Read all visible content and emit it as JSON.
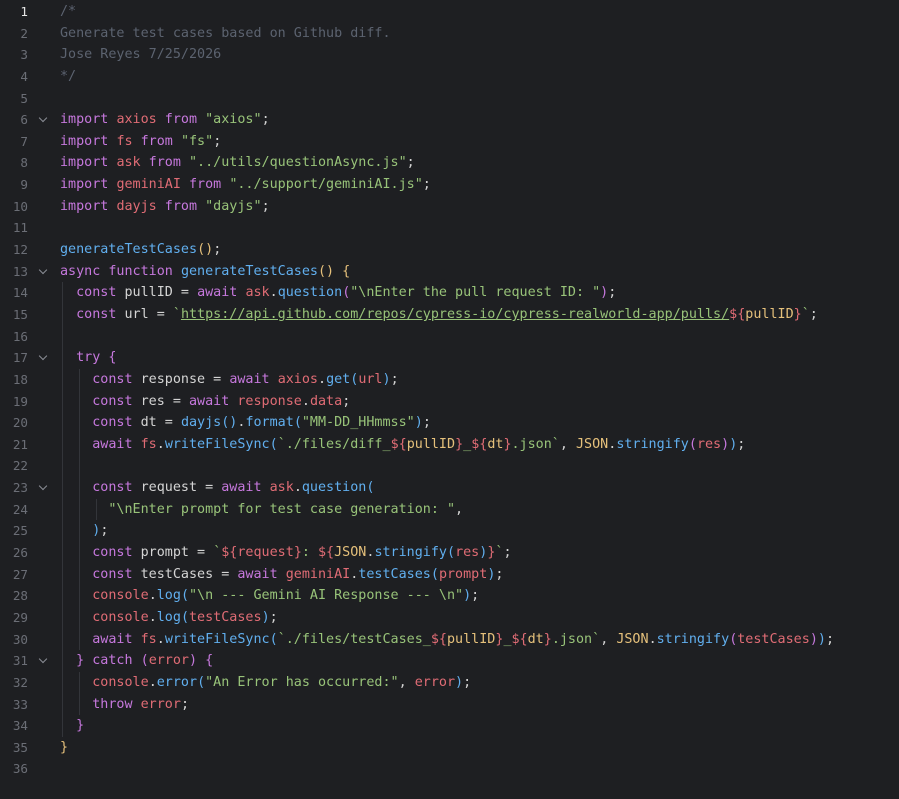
{
  "editor": {
    "active_line": 1,
    "lines": [
      {
        "num": "1",
        "indent": 0,
        "tokens": [
          {
            "t": "/*",
            "c": "cm"
          }
        ]
      },
      {
        "num": "2",
        "indent": 0,
        "tokens": [
          {
            "t": "Generate test cases based on Github diff.",
            "c": "cm"
          }
        ]
      },
      {
        "num": "3",
        "indent": 0,
        "tokens": [
          {
            "t": "Jose Reyes 7/25/2026",
            "c": "cm"
          }
        ]
      },
      {
        "num": "4",
        "indent": 0,
        "tokens": [
          {
            "t": "*/",
            "c": "cm"
          }
        ]
      },
      {
        "num": "5",
        "indent": 0,
        "tokens": []
      },
      {
        "num": "6",
        "indent": 0,
        "fold": true,
        "tokens": [
          {
            "t": "import ",
            "c": "kw"
          },
          {
            "t": "axios",
            "c": "id"
          },
          {
            "t": " from ",
            "c": "kw"
          },
          {
            "t": "\"axios\"",
            "c": "st"
          },
          {
            "t": ";",
            "c": "pl"
          }
        ]
      },
      {
        "num": "7",
        "indent": 0,
        "tokens": [
          {
            "t": "import ",
            "c": "kw"
          },
          {
            "t": "fs",
            "c": "id"
          },
          {
            "t": " from ",
            "c": "kw"
          },
          {
            "t": "\"fs\"",
            "c": "st"
          },
          {
            "t": ";",
            "c": "pl"
          }
        ]
      },
      {
        "num": "8",
        "indent": 0,
        "tokens": [
          {
            "t": "import ",
            "c": "kw"
          },
          {
            "t": "ask",
            "c": "id"
          },
          {
            "t": " from ",
            "c": "kw"
          },
          {
            "t": "\"../utils/questionAsync.js\"",
            "c": "st"
          },
          {
            "t": ";",
            "c": "pl"
          }
        ]
      },
      {
        "num": "9",
        "indent": 0,
        "tokens": [
          {
            "t": "import ",
            "c": "kw"
          },
          {
            "t": "geminiAI",
            "c": "id"
          },
          {
            "t": " from ",
            "c": "kw"
          },
          {
            "t": "\"../support/geminiAI.js\"",
            "c": "st"
          },
          {
            "t": ";",
            "c": "pl"
          }
        ]
      },
      {
        "num": "10",
        "indent": 0,
        "tokens": [
          {
            "t": "import ",
            "c": "kw"
          },
          {
            "t": "dayjs",
            "c": "id"
          },
          {
            "t": " from ",
            "c": "kw"
          },
          {
            "t": "\"dayjs\"",
            "c": "st"
          },
          {
            "t": ";",
            "c": "pl"
          }
        ]
      },
      {
        "num": "11",
        "indent": 0,
        "tokens": []
      },
      {
        "num": "12",
        "indent": 0,
        "tokens": [
          {
            "t": "generateTestCases",
            "c": "fn"
          },
          {
            "t": "()",
            "c": "p1"
          },
          {
            "t": ";",
            "c": "pl"
          }
        ]
      },
      {
        "num": "13",
        "indent": 0,
        "fold": true,
        "tokens": [
          {
            "t": "async function ",
            "c": "kw"
          },
          {
            "t": "generateTestCases",
            "c": "fn"
          },
          {
            "t": "() {",
            "c": "p1"
          }
        ]
      },
      {
        "num": "14",
        "indent": 1,
        "tokens": [
          {
            "t": "  const ",
            "c": "kw"
          },
          {
            "t": "pullID",
            "c": "pl"
          },
          {
            "t": " = ",
            "c": "pl"
          },
          {
            "t": "await ",
            "c": "kw"
          },
          {
            "t": "ask",
            "c": "id"
          },
          {
            "t": ".",
            "c": "pl"
          },
          {
            "t": "question",
            "c": "fn"
          },
          {
            "t": "(",
            "c": "p2"
          },
          {
            "t": "\"\\nEnter the pull request ID: \"",
            "c": "st"
          },
          {
            "t": ")",
            "c": "p2"
          },
          {
            "t": ";",
            "c": "pl"
          }
        ]
      },
      {
        "num": "15",
        "indent": 1,
        "tokens": [
          {
            "t": "  const ",
            "c": "kw"
          },
          {
            "t": "url",
            "c": "pl"
          },
          {
            "t": " = ",
            "c": "pl"
          },
          {
            "t": "`",
            "c": "st"
          },
          {
            "t": "https://api.github.com/repos/cypress-io/cypress-realworld-app/pulls/",
            "c": "url"
          },
          {
            "t": "${",
            "c": "tp"
          },
          {
            "t": "pullID",
            "c": "in"
          },
          {
            "t": "}",
            "c": "tp"
          },
          {
            "t": "`",
            "c": "st"
          },
          {
            "t": ";",
            "c": "pl"
          }
        ]
      },
      {
        "num": "16",
        "indent": 1,
        "tokens": []
      },
      {
        "num": "17",
        "indent": 1,
        "fold": true,
        "tokens": [
          {
            "t": "  try ",
            "c": "kw"
          },
          {
            "t": "{",
            "c": "p2"
          }
        ]
      },
      {
        "num": "18",
        "indent": 2,
        "tokens": [
          {
            "t": "    const ",
            "c": "kw"
          },
          {
            "t": "response",
            "c": "pl"
          },
          {
            "t": " = ",
            "c": "pl"
          },
          {
            "t": "await ",
            "c": "kw"
          },
          {
            "t": "axios",
            "c": "id"
          },
          {
            "t": ".",
            "c": "pl"
          },
          {
            "t": "get",
            "c": "fn"
          },
          {
            "t": "(",
            "c": "p3"
          },
          {
            "t": "url",
            "c": "id"
          },
          {
            "t": ")",
            "c": "p3"
          },
          {
            "t": ";",
            "c": "pl"
          }
        ]
      },
      {
        "num": "19",
        "indent": 2,
        "tokens": [
          {
            "t": "    const ",
            "c": "kw"
          },
          {
            "t": "res",
            "c": "pl"
          },
          {
            "t": " = ",
            "c": "pl"
          },
          {
            "t": "await ",
            "c": "kw"
          },
          {
            "t": "response",
            "c": "id"
          },
          {
            "t": ".",
            "c": "pl"
          },
          {
            "t": "data",
            "c": "id"
          },
          {
            "t": ";",
            "c": "pl"
          }
        ]
      },
      {
        "num": "20",
        "indent": 2,
        "tokens": [
          {
            "t": "    const ",
            "c": "kw"
          },
          {
            "t": "dt",
            "c": "pl"
          },
          {
            "t": " = ",
            "c": "pl"
          },
          {
            "t": "dayjs",
            "c": "fn"
          },
          {
            "t": "()",
            "c": "p3"
          },
          {
            "t": ".",
            "c": "pl"
          },
          {
            "t": "format",
            "c": "fn"
          },
          {
            "t": "(",
            "c": "p3"
          },
          {
            "t": "\"MM-DD_HHmmss\"",
            "c": "st"
          },
          {
            "t": ")",
            "c": "p3"
          },
          {
            "t": ";",
            "c": "pl"
          }
        ]
      },
      {
        "num": "21",
        "indent": 2,
        "tokens": [
          {
            "t": "    await ",
            "c": "kw"
          },
          {
            "t": "fs",
            "c": "id"
          },
          {
            "t": ".",
            "c": "pl"
          },
          {
            "t": "writeFileSync",
            "c": "fn"
          },
          {
            "t": "(",
            "c": "p3"
          },
          {
            "t": "`./files/diff_",
            "c": "st"
          },
          {
            "t": "${",
            "c": "tp"
          },
          {
            "t": "pullID",
            "c": "in"
          },
          {
            "t": "}",
            "c": "tp"
          },
          {
            "t": "_",
            "c": "st"
          },
          {
            "t": "${",
            "c": "tp"
          },
          {
            "t": "dt",
            "c": "in"
          },
          {
            "t": "}",
            "c": "tp"
          },
          {
            "t": ".json`",
            "c": "st"
          },
          {
            "t": ", ",
            "c": "pl"
          },
          {
            "t": "JSON",
            "c": "in"
          },
          {
            "t": ".",
            "c": "pl"
          },
          {
            "t": "stringify",
            "c": "fn"
          },
          {
            "t": "(",
            "c": "p2"
          },
          {
            "t": "res",
            "c": "id"
          },
          {
            "t": ")",
            "c": "p2"
          },
          {
            "t": ")",
            "c": "p3"
          },
          {
            "t": ";",
            "c": "pl"
          }
        ]
      },
      {
        "num": "22",
        "indent": 2,
        "tokens": []
      },
      {
        "num": "23",
        "indent": 2,
        "fold": true,
        "tokens": [
          {
            "t": "    const ",
            "c": "kw"
          },
          {
            "t": "request",
            "c": "pl"
          },
          {
            "t": " = ",
            "c": "pl"
          },
          {
            "t": "await ",
            "c": "kw"
          },
          {
            "t": "ask",
            "c": "id"
          },
          {
            "t": ".",
            "c": "pl"
          },
          {
            "t": "question",
            "c": "fn"
          },
          {
            "t": "(",
            "c": "p3"
          }
        ]
      },
      {
        "num": "24",
        "indent": 3,
        "tokens": [
          {
            "t": "      \"\\nEnter prompt for test case generation: \"",
            "c": "st"
          },
          {
            "t": ",",
            "c": "pl"
          }
        ]
      },
      {
        "num": "25",
        "indent": 2,
        "tokens": [
          {
            "t": "    )",
            "c": "p3"
          },
          {
            "t": ";",
            "c": "pl"
          }
        ]
      },
      {
        "num": "26",
        "indent": 2,
        "tokens": [
          {
            "t": "    const ",
            "c": "kw"
          },
          {
            "t": "prompt",
            "c": "pl"
          },
          {
            "t": " = ",
            "c": "pl"
          },
          {
            "t": "`",
            "c": "st"
          },
          {
            "t": "${",
            "c": "tp"
          },
          {
            "t": "request",
            "c": "id"
          },
          {
            "t": "}",
            "c": "tp"
          },
          {
            "t": ": ",
            "c": "st"
          },
          {
            "t": "${",
            "c": "tp"
          },
          {
            "t": "JSON",
            "c": "in"
          },
          {
            "t": ".",
            "c": "pl"
          },
          {
            "t": "stringify",
            "c": "fn"
          },
          {
            "t": "(",
            "c": "p3"
          },
          {
            "t": "res",
            "c": "id"
          },
          {
            "t": ")",
            "c": "p3"
          },
          {
            "t": "}",
            "c": "tp"
          },
          {
            "t": "`",
            "c": "st"
          },
          {
            "t": ";",
            "c": "pl"
          }
        ]
      },
      {
        "num": "27",
        "indent": 2,
        "tokens": [
          {
            "t": "    const ",
            "c": "kw"
          },
          {
            "t": "testCases",
            "c": "pl"
          },
          {
            "t": " = ",
            "c": "pl"
          },
          {
            "t": "await ",
            "c": "kw"
          },
          {
            "t": "geminiAI",
            "c": "id"
          },
          {
            "t": ".",
            "c": "pl"
          },
          {
            "t": "testCases",
            "c": "fn"
          },
          {
            "t": "(",
            "c": "p3"
          },
          {
            "t": "prompt",
            "c": "id"
          },
          {
            "t": ")",
            "c": "p3"
          },
          {
            "t": ";",
            "c": "pl"
          }
        ]
      },
      {
        "num": "28",
        "indent": 2,
        "tokens": [
          {
            "t": "    console",
            "c": "id"
          },
          {
            "t": ".",
            "c": "pl"
          },
          {
            "t": "log",
            "c": "fn"
          },
          {
            "t": "(",
            "c": "p3"
          },
          {
            "t": "\"\\n --- Gemini AI Response --- \\n\"",
            "c": "st"
          },
          {
            "t": ")",
            "c": "p3"
          },
          {
            "t": ";",
            "c": "pl"
          }
        ]
      },
      {
        "num": "29",
        "indent": 2,
        "tokens": [
          {
            "t": "    console",
            "c": "id"
          },
          {
            "t": ".",
            "c": "pl"
          },
          {
            "t": "log",
            "c": "fn"
          },
          {
            "t": "(",
            "c": "p3"
          },
          {
            "t": "testCases",
            "c": "id"
          },
          {
            "t": ")",
            "c": "p3"
          },
          {
            "t": ";",
            "c": "pl"
          }
        ]
      },
      {
        "num": "30",
        "indent": 2,
        "tokens": [
          {
            "t": "    await ",
            "c": "kw"
          },
          {
            "t": "fs",
            "c": "id"
          },
          {
            "t": ".",
            "c": "pl"
          },
          {
            "t": "writeFileSync",
            "c": "fn"
          },
          {
            "t": "(",
            "c": "p3"
          },
          {
            "t": "`./files/testCases_",
            "c": "st"
          },
          {
            "t": "${",
            "c": "tp"
          },
          {
            "t": "pullID",
            "c": "in"
          },
          {
            "t": "}",
            "c": "tp"
          },
          {
            "t": "_",
            "c": "st"
          },
          {
            "t": "${",
            "c": "tp"
          },
          {
            "t": "dt",
            "c": "in"
          },
          {
            "t": "}",
            "c": "tp"
          },
          {
            "t": ".json`",
            "c": "st"
          },
          {
            "t": ", ",
            "c": "pl"
          },
          {
            "t": "JSON",
            "c": "in"
          },
          {
            "t": ".",
            "c": "pl"
          },
          {
            "t": "stringify",
            "c": "fn"
          },
          {
            "t": "(",
            "c": "p2"
          },
          {
            "t": "testCases",
            "c": "id"
          },
          {
            "t": ")",
            "c": "p2"
          },
          {
            "t": ")",
            "c": "p3"
          },
          {
            "t": ";",
            "c": "pl"
          }
        ]
      },
      {
        "num": "31",
        "indent": 1,
        "fold": true,
        "tokens": [
          {
            "t": "  } ",
            "c": "p2"
          },
          {
            "t": "catch ",
            "c": "kw"
          },
          {
            "t": "(",
            "c": "p2"
          },
          {
            "t": "error",
            "c": "id"
          },
          {
            "t": ") {",
            "c": "p2"
          }
        ]
      },
      {
        "num": "32",
        "indent": 2,
        "tokens": [
          {
            "t": "    console",
            "c": "id"
          },
          {
            "t": ".",
            "c": "pl"
          },
          {
            "t": "error",
            "c": "fn"
          },
          {
            "t": "(",
            "c": "p3"
          },
          {
            "t": "\"An Error has occurred:\"",
            "c": "st"
          },
          {
            "t": ", ",
            "c": "pl"
          },
          {
            "t": "error",
            "c": "id"
          },
          {
            "t": ")",
            "c": "p3"
          },
          {
            "t": ";",
            "c": "pl"
          }
        ]
      },
      {
        "num": "33",
        "indent": 2,
        "tokens": [
          {
            "t": "    throw ",
            "c": "kw"
          },
          {
            "t": "error",
            "c": "id"
          },
          {
            "t": ";",
            "c": "pl"
          }
        ]
      },
      {
        "num": "34",
        "indent": 1,
        "tokens": [
          {
            "t": "  }",
            "c": "p2"
          }
        ]
      },
      {
        "num": "35",
        "indent": 0,
        "tokens": [
          {
            "t": "}",
            "c": "p1"
          }
        ]
      },
      {
        "num": "36",
        "indent": 0,
        "tokens": []
      }
    ]
  }
}
